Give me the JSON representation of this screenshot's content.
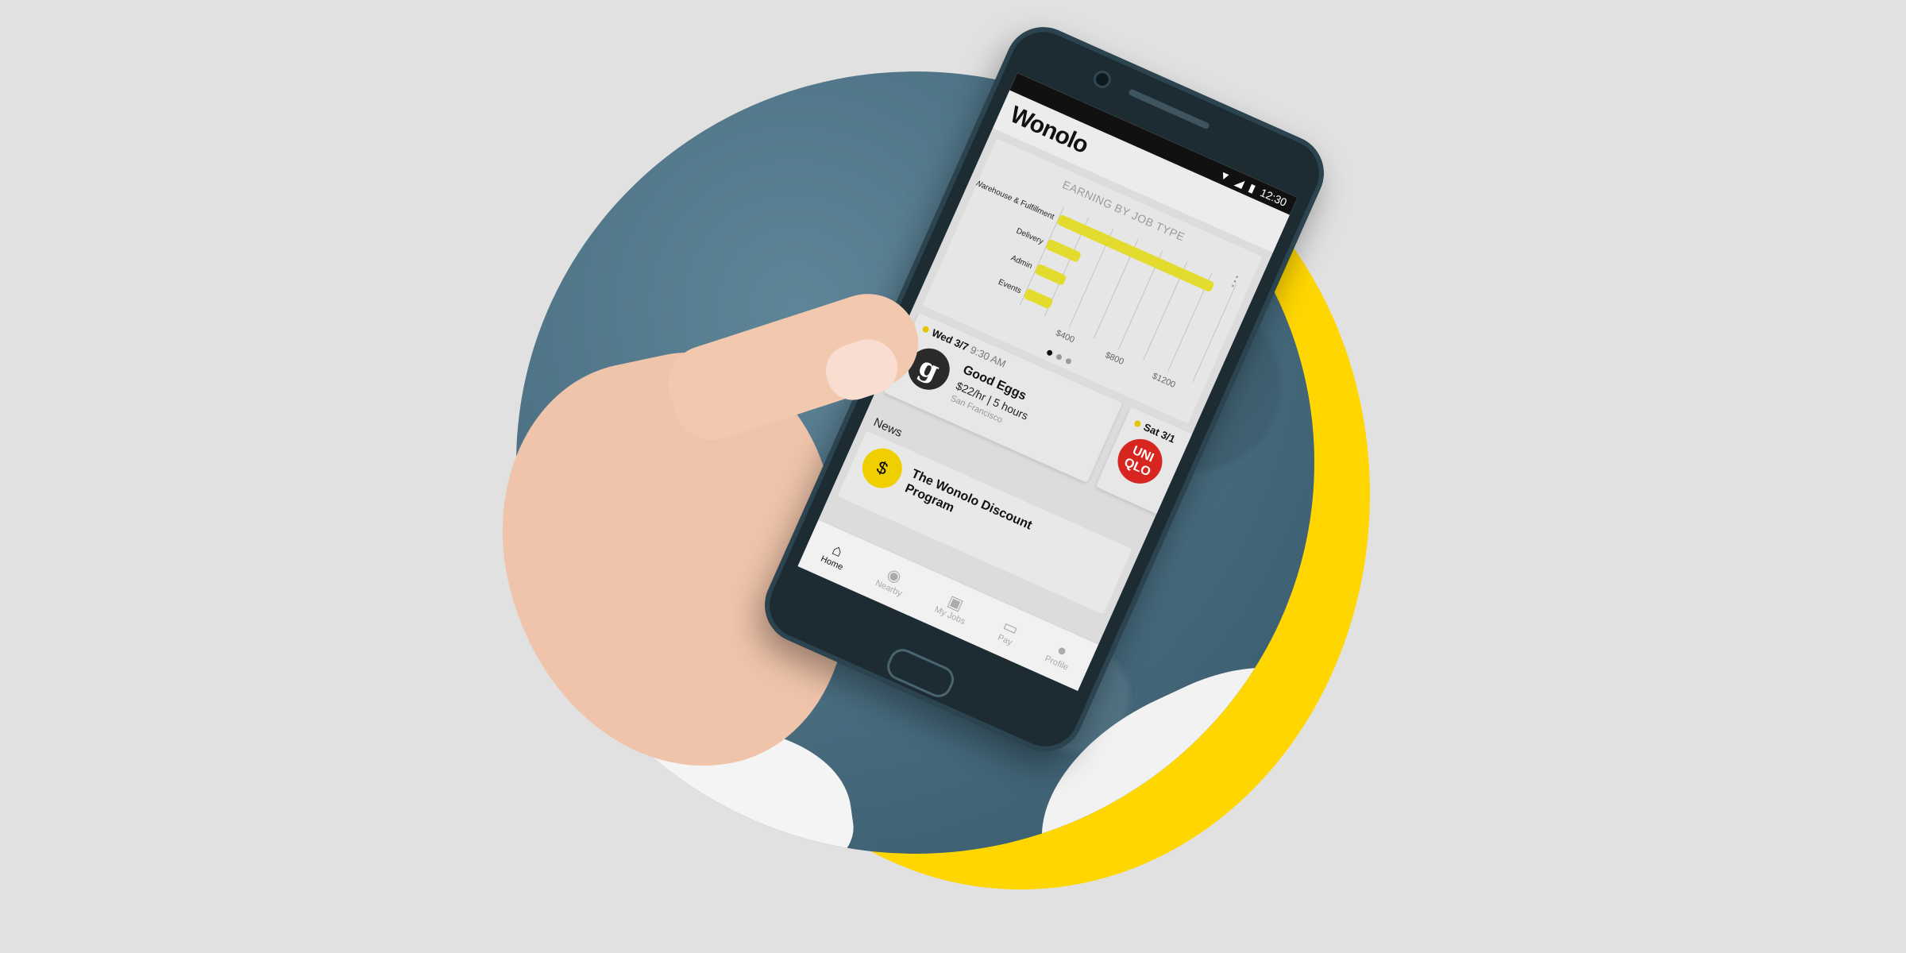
{
  "app": {
    "logo_text": "Wonolo"
  },
  "status_bar": {
    "time": "12:30",
    "icons": [
      "wifi-icon",
      "signal-icon",
      "battery-icon"
    ]
  },
  "chart_data": {
    "type": "bar",
    "title": "EARNING BY JOB TYPE",
    "categories": [
      "Warehouse & Fulfillment",
      "Delivery",
      "Admin",
      "Events"
    ],
    "values": [
      1250,
      260,
      230,
      210
    ],
    "xticks": [
      "$400",
      "$800",
      "$1200"
    ],
    "xlim": [
      0,
      1400
    ],
    "bar_color": "#e3dc2e",
    "pager_dots": 3,
    "active_dot": 0
  },
  "jobs": [
    {
      "date": "Wed 3/7",
      "time": "9:30 AM",
      "company": "Good Eggs",
      "rate": "$22/hr | 5 hours",
      "location": "San Francisco",
      "logo_letter": "g"
    },
    {
      "date": "Sat 3/1",
      "logo_text": "UNI QLO"
    }
  ],
  "news": {
    "label": "News",
    "items": [
      {
        "title": "The Wonolo Discount Program",
        "icon": "money-bag-icon"
      }
    ]
  },
  "bottom_nav": [
    {
      "label": "Home",
      "icon": "home-icon",
      "active": true
    },
    {
      "label": "Nearby",
      "icon": "location-pin-icon"
    },
    {
      "label": "My Jobs",
      "icon": "briefcase-icon"
    },
    {
      "label": "Pay",
      "icon": "wallet-icon"
    },
    {
      "label": "Profile",
      "icon": "person-icon"
    }
  ],
  "colors": {
    "background": "#e1e1e1",
    "accent_yellow": "#ffd600",
    "photo_blue": "#4e7386"
  }
}
